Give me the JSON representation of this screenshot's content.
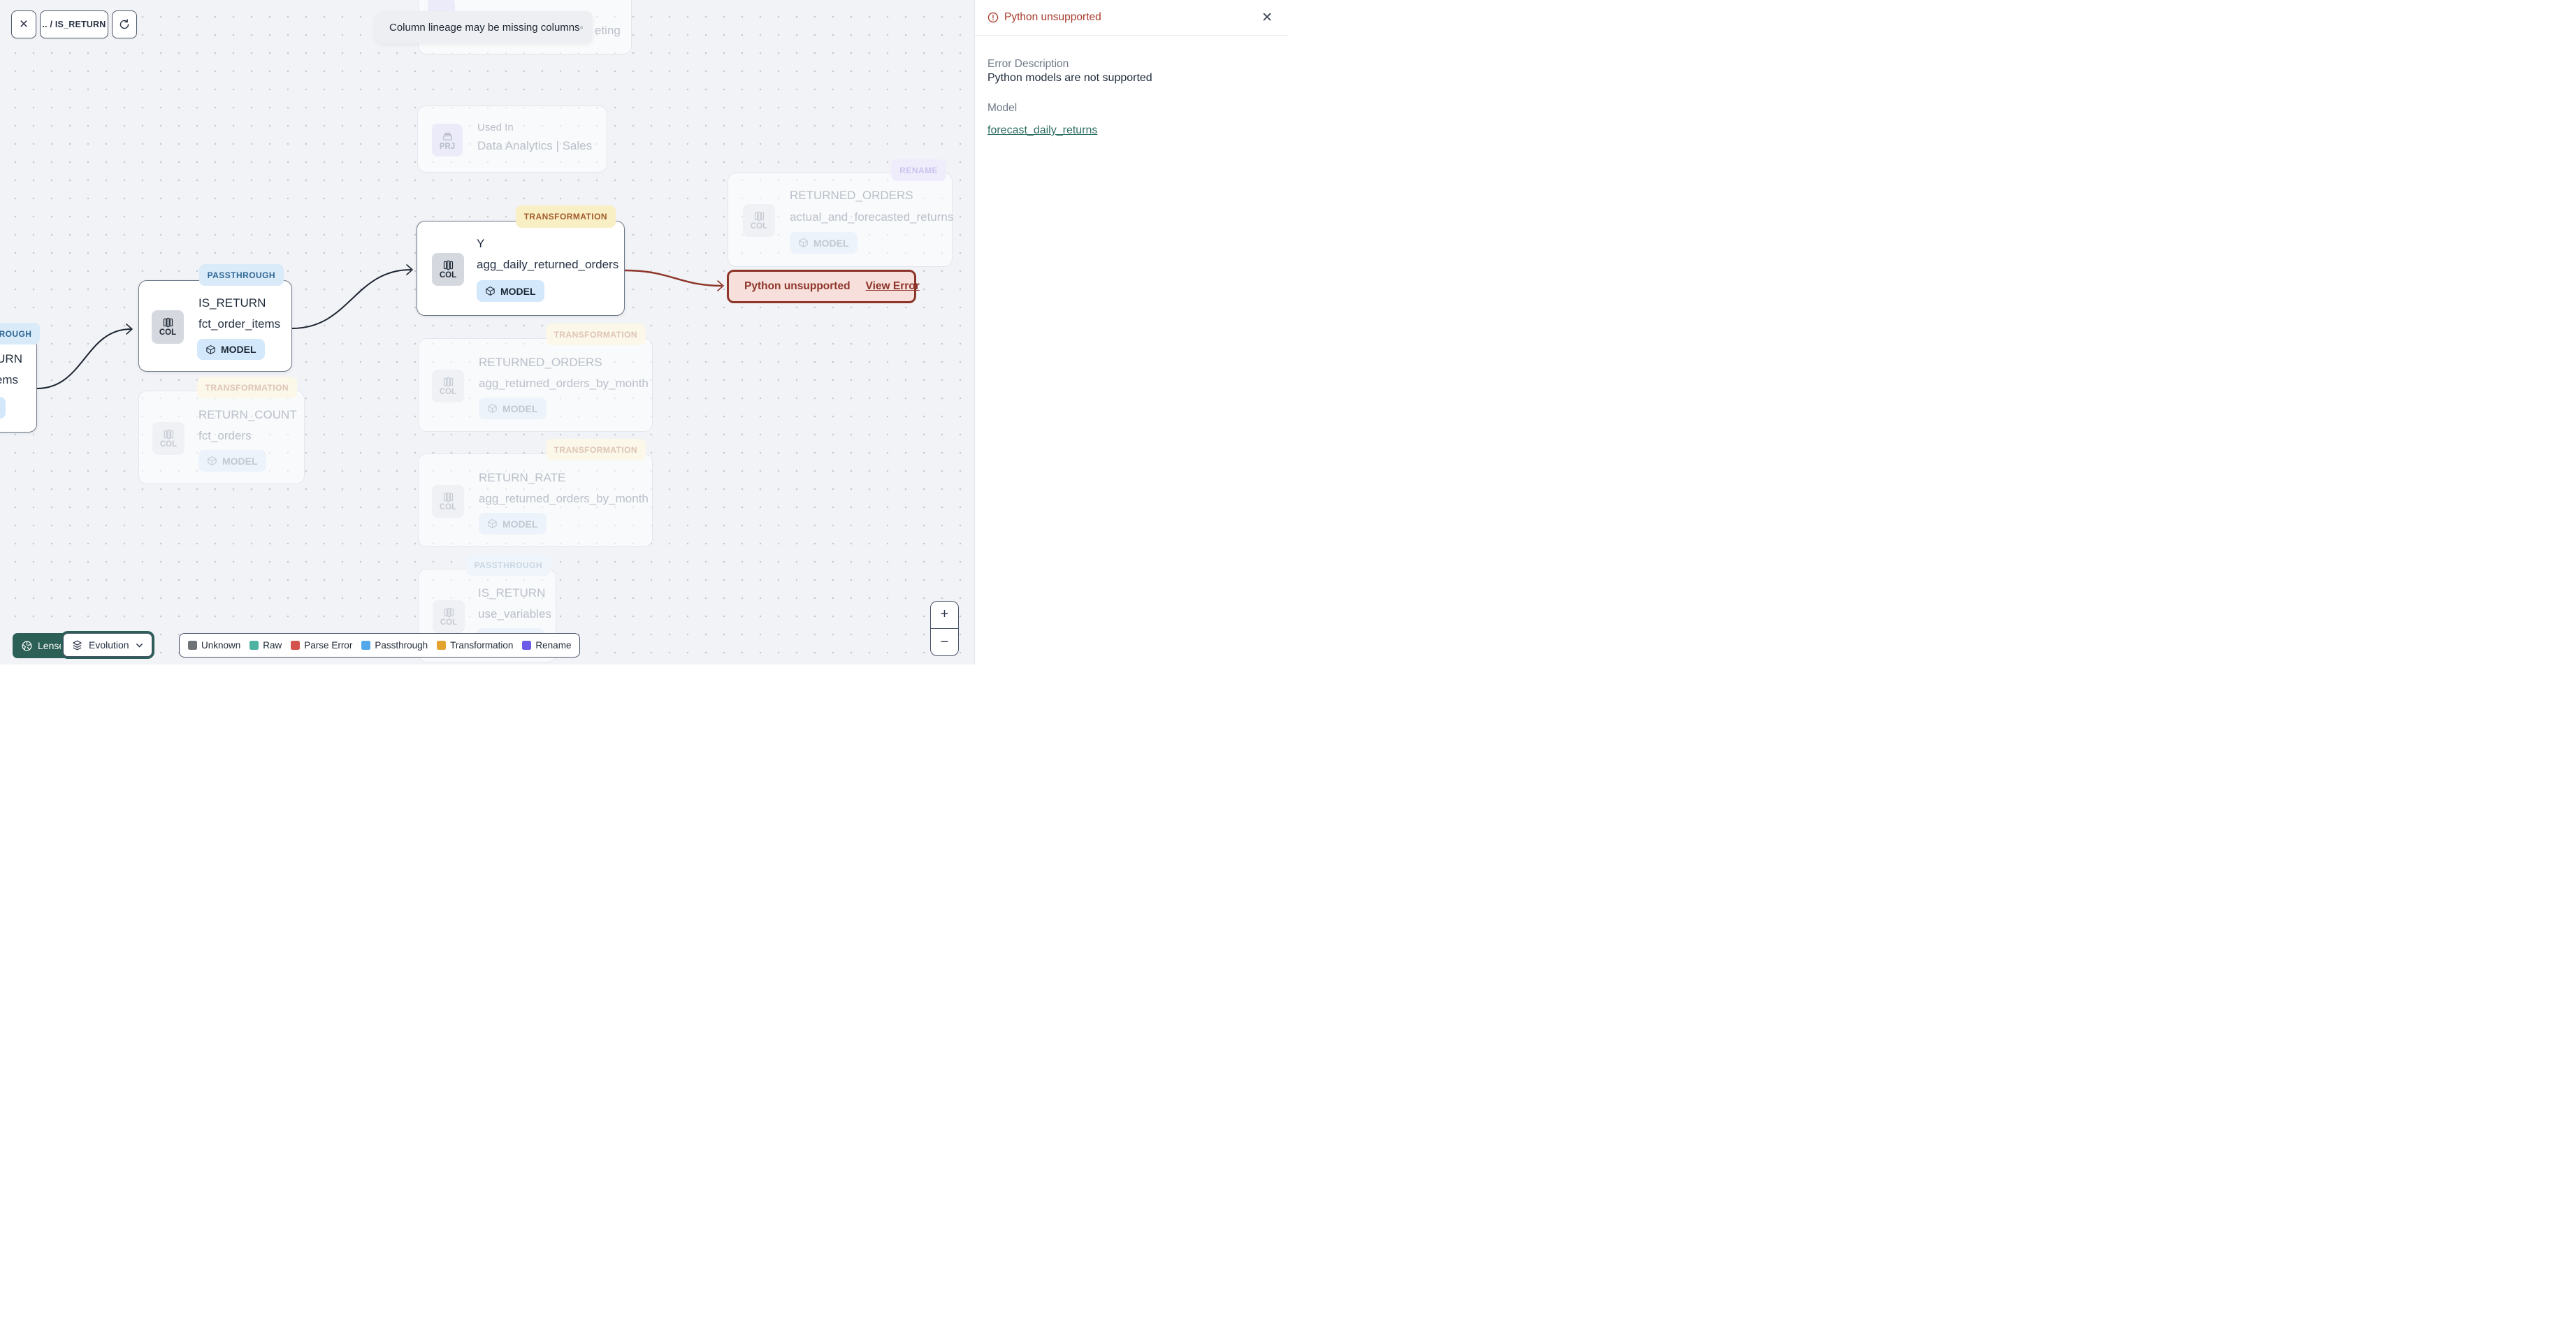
{
  "toolbar": {
    "breadcrumb": ".. / IS_RETURN"
  },
  "notification": {
    "text": "Column lineage may be missing columns"
  },
  "labels": {
    "model": "MODEL",
    "col": "COL",
    "prj": "PRJ"
  },
  "nodes": {
    "hidden_top": {
      "title_fragment": "eting"
    },
    "used_in_sales": {
      "label": "Used In",
      "title": "Data Analytics | Sales"
    },
    "rename_node": {
      "badge": "RENAME",
      "title": "RETURNED_ORDERS",
      "subtitle": "actual_and_forecasted_returns"
    },
    "main": {
      "badge": "TRANSFORMATION",
      "label": "Y",
      "title": "agg_daily_returned_orders"
    },
    "passthrough_node": {
      "badge": "PASSTHROUGH",
      "title": "IS_RETURN",
      "subtitle": "fct_order_items"
    },
    "left_partial": {
      "badge": "PASSTHROUGH",
      "title": "IS_RETURN",
      "subtitle": "fct_order_items"
    },
    "return_count": {
      "badge": "TRANSFORMATION",
      "title": "RETURN_COUNT",
      "subtitle": "fct_orders"
    },
    "returned_orders_month": {
      "badge": "TRANSFORMATION",
      "title": "RETURNED_ORDERS",
      "subtitle": "agg_returned_orders_by_month"
    },
    "return_rate": {
      "badge": "TRANSFORMATION",
      "title": "RETURN_RATE",
      "subtitle": "agg_returned_orders_by_month"
    },
    "use_variables": {
      "badge": "PASSTHROUGH",
      "title": "IS_RETURN",
      "subtitle": "use_variables"
    }
  },
  "error_node": {
    "text": "Python unsupported",
    "link": "View Error"
  },
  "panel": {
    "title": "Python unsupported",
    "error_description_label": "Error Description",
    "error_description": "Python models are not supported",
    "model_label": "Model",
    "model_link": "forecast_daily_returns"
  },
  "footer": {
    "lenses": "Lenses",
    "lens_selected": "Evolution"
  },
  "legend": {
    "items": [
      {
        "label": "Unknown",
        "color": "#6f7277"
      },
      {
        "label": "Raw",
        "color": "#4fb3a1"
      },
      {
        "label": "Parse Error",
        "color": "#d4534e"
      },
      {
        "label": "Passthrough",
        "color": "#54a8ea"
      },
      {
        "label": "Transformation",
        "color": "#e3a42f"
      },
      {
        "label": "Rename",
        "color": "#6b5be6"
      }
    ]
  },
  "zoom": {
    "in": "+",
    "out": "−"
  },
  "colors": {
    "error": "#8e352a",
    "link": "#2d6e62",
    "accent_teal": "#2c5f55"
  }
}
